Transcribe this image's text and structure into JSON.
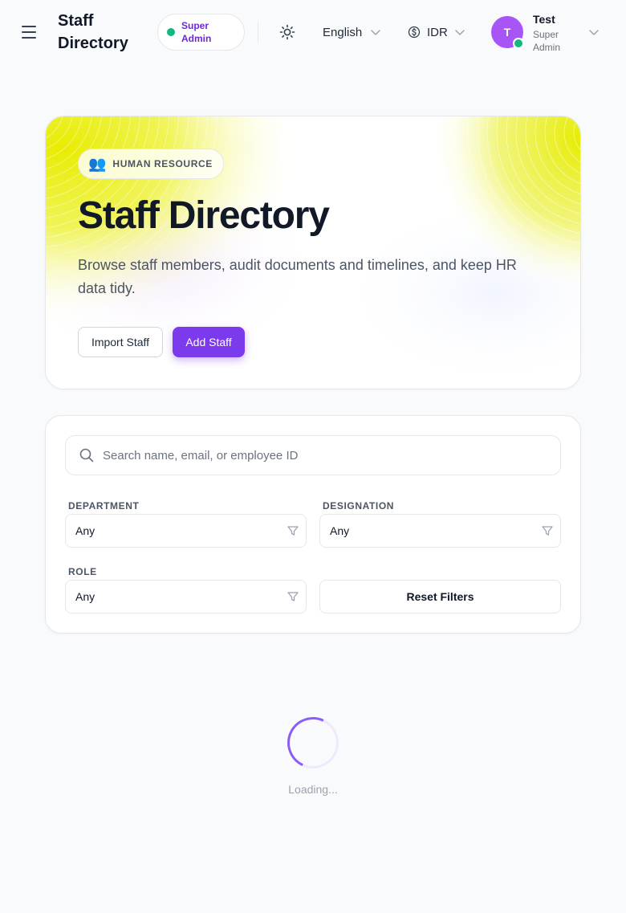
{
  "header": {
    "title": "Staff Directory",
    "role_badge": "Super Admin",
    "language": "English",
    "currency": "IDR",
    "user": {
      "initial": "T",
      "name": "Test",
      "role": "Super Admin"
    }
  },
  "hero": {
    "badge_icon": "👥",
    "badge_label": "HUMAN RESOURCE",
    "title": "Staff Directory",
    "subtitle": "Browse staff members, audit documents and timelines, and keep HR data tidy.",
    "import_label": "Import Staff",
    "add_label": "Add Staff"
  },
  "filters": {
    "search_placeholder": "Search name, email, or employee ID",
    "department_label": "DEPARTMENT",
    "department_value": "Any",
    "designation_label": "DESIGNATION",
    "designation_value": "Any",
    "role_label": "ROLE",
    "role_value": "Any",
    "reset_label": "Reset Filters"
  },
  "status": {
    "loading_text": "Loading..."
  },
  "colors": {
    "accent": "#7c3aed",
    "online": "#10b981",
    "avatar": "#a855f7"
  }
}
